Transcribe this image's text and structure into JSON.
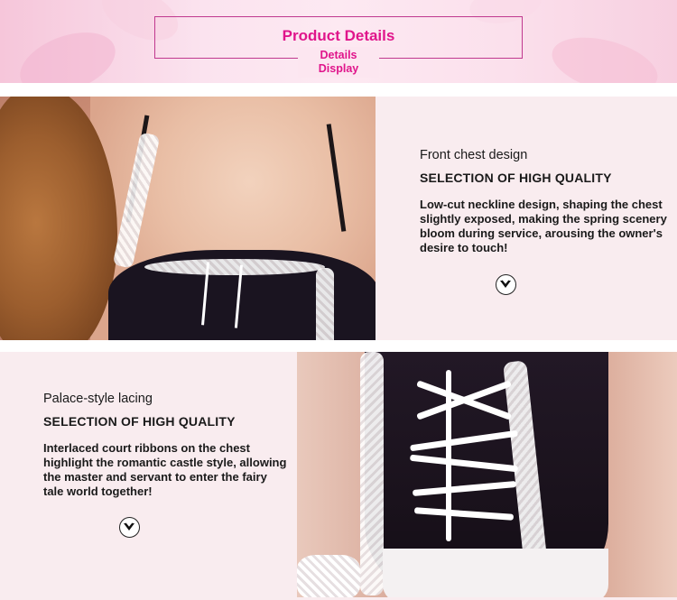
{
  "header": {
    "title": "Product Details",
    "subtitle_line1": "Details",
    "subtitle_line2": "Display"
  },
  "sections": [
    {
      "heading": "Front chest design",
      "quality": "SELECTION OF HIGH QUALITY",
      "description": "Low-cut neckline design, shaping the chest slightly exposed, making the spring scenery bloom during service, arousing the owner's desire to touch!",
      "icon": "chevron-down-circle-icon"
    },
    {
      "heading": "Palace-style lacing",
      "quality": "SELECTION OF HIGH QUALITY",
      "description": "Interlaced court ribbons on the chest highlight the romantic castle style, allowing the master and servant to enter the fairy tale world together!",
      "icon": "chevron-down-circle-icon"
    }
  ],
  "colors": {
    "accent": "#e0158b",
    "border": "#c0398f",
    "panel_bg": "#f9ecef",
    "text": "#1a1a1a"
  }
}
